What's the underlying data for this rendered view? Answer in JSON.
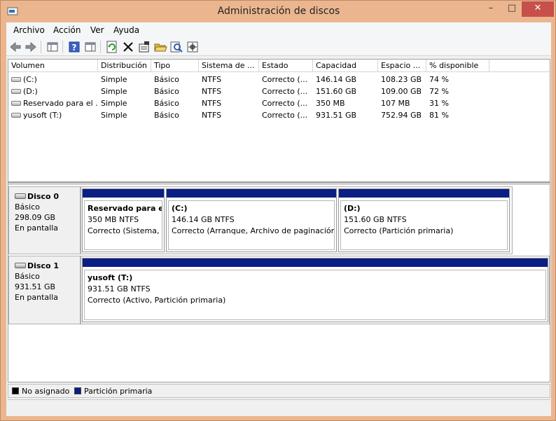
{
  "window": {
    "title": "Administración de discos",
    "min_glyph": "–",
    "max_glyph": "□",
    "close_glyph": "✕"
  },
  "menu": [
    {
      "label": "Archivo"
    },
    {
      "label": "Acción"
    },
    {
      "label": "Ver"
    },
    {
      "label": "Ayuda"
    }
  ],
  "toolbar": [
    {
      "icon": "back-arrow-icon"
    },
    {
      "icon": "forward-arrow-icon"
    },
    {
      "icon": "console-tree-icon"
    },
    {
      "icon": "help-icon"
    },
    {
      "icon": "action-pane-icon"
    },
    {
      "icon": "refresh-icon"
    },
    {
      "icon": "delete-icon"
    },
    {
      "icon": "properties-icon"
    },
    {
      "icon": "open-folder-icon"
    },
    {
      "icon": "search-icon"
    },
    {
      "icon": "settings-icon"
    }
  ],
  "volumes": {
    "columns": [
      "Volumen",
      "Distribución",
      "Tipo",
      "Sistema de ...",
      "Estado",
      "Capacidad",
      "Espacio ...",
      "% disponible"
    ],
    "rows": [
      [
        "(C:)",
        "Simple",
        "Básico",
        "NTFS",
        "Correcto (...",
        "146.14 GB",
        "108.23 GB",
        "74 %"
      ],
      [
        "(D:)",
        "Simple",
        "Básico",
        "NTFS",
        "Correcto (...",
        "151.60 GB",
        "109.00 GB",
        "72 %"
      ],
      [
        "Reservado para el ...",
        "Simple",
        "Básico",
        "NTFS",
        "Correcto (...",
        "350 MB",
        "107 MB",
        "31 %"
      ],
      [
        "yusoft  (T:)",
        "Simple",
        "Básico",
        "NTFS",
        "Correcto (...",
        "931.51 GB",
        "752.94 GB",
        "81 %"
      ]
    ]
  },
  "disks": [
    {
      "name": "Disco 0",
      "type": "Básico",
      "size": "298.09 GB",
      "status": "En pantalla",
      "partitions": [
        {
          "name": "Reservado para el s",
          "size": "350 MB NTFS",
          "status": "Correcto (Sistema, A"
        },
        {
          "name": "(C:)",
          "size": "146.14 GB NTFS",
          "status": "Correcto (Arranque, Archivo de paginación,"
        },
        {
          "name": "(D:)",
          "size": "151.60 GB NTFS",
          "status": "Correcto (Partición primaria)"
        }
      ]
    },
    {
      "name": "Disco 1",
      "type": "Básico",
      "size": "931.51 GB",
      "status": "En pantalla",
      "partitions": [
        {
          "name": "yusoft   (T:)",
          "size": "931.51 GB NTFS",
          "status": "Correcto (Activo, Partición primaria)"
        }
      ]
    }
  ],
  "legend": [
    {
      "label": "No asignado",
      "color": "#000000"
    },
    {
      "label": "Partición primaria",
      "color": "#0a1e84"
    }
  ]
}
